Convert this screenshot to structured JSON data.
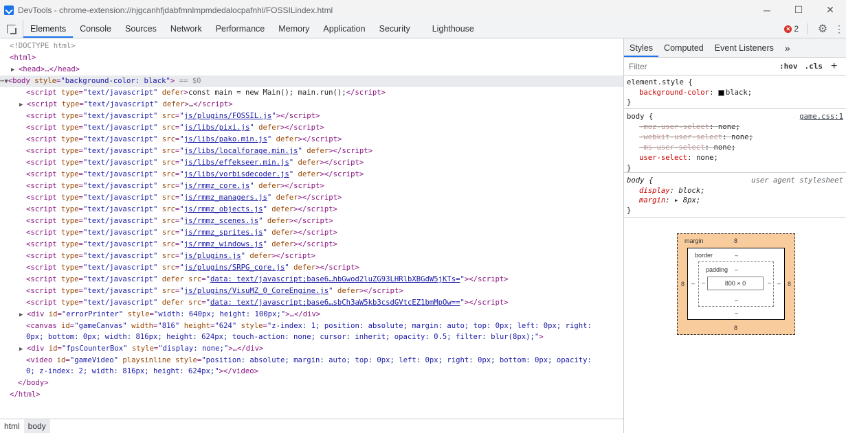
{
  "window": {
    "title": "DevTools - chrome-extension://njgcanhfjdabfmnlmpmdedalocpafnhl/FOSSILindex.html",
    "controls": [
      "─",
      "☐",
      "✕"
    ]
  },
  "tabs": [
    "Elements",
    "Console",
    "Sources",
    "Network",
    "Performance",
    "Memory",
    "Application",
    "Security",
    "Lighthouse"
  ],
  "active_tab": "Elements",
  "error_count": "2",
  "dom": {
    "doctype": "<!DOCTYPE html>",
    "html_open": "<html>",
    "head": "<head>…</head>",
    "body_open_tag": "<body",
    "body_style_attr": "style",
    "body_style_val": "\"background-color: black\"",
    "body_close_bracket": ">",
    "body_eq": " == $0",
    "scripts": [
      {
        "pre": "type",
        "preval": "\"text/javascript\"",
        "kind": "defer-inline",
        "content": "const main = new Main(); main.run();"
      },
      {
        "pre": "type",
        "preval": "\"text/javascript\"",
        "kind": "defer-collapsed",
        "content": "…"
      },
      {
        "src": "js/plugins/FOSSIL.js",
        "defer": false
      },
      {
        "src": "js/libs/pixi.js",
        "defer": true
      },
      {
        "src": "js/libs/pako.min.js",
        "defer": true
      },
      {
        "src": "js/libs/localforage.min.js",
        "defer": true
      },
      {
        "src": "js/libs/effekseer.min.js",
        "defer": true
      },
      {
        "src": "js/libs/vorbisdecoder.js",
        "defer": true
      },
      {
        "src": "js/rmmz_core.js",
        "defer": true
      },
      {
        "src": "js/rmmz_managers.js",
        "defer": true
      },
      {
        "src": "js/rmmz_objects.js",
        "defer": true
      },
      {
        "src": "js/rmmz_scenes.js",
        "defer": true
      },
      {
        "src": "js/rmmz_sprites.js",
        "defer": true
      },
      {
        "src": "js/rmmz_windows.js",
        "defer": true
      },
      {
        "src": "js/plugins.js",
        "defer": true
      },
      {
        "src": "js/plugins/SRPG_core.js",
        "defer": true
      }
    ],
    "data_script_1": "data: text/javascript;base6…hbGwod2luZG93LHRlbXBGdW5jKTs=",
    "visumz_src": "js/plugins/VisuMZ_0_CoreEngine.js",
    "data_script_2": "data: text/javascript;base6…sbCh3aW5kb3csdGVtcEZ1bmMpOw==",
    "error_printer_id": "\"errorPrinter\"",
    "error_printer_style": "\"width: 640px; height: 100px;\"",
    "canvas_line1_a": "\"gameCanvas\"",
    "canvas_width": "\"816\"",
    "canvas_height": "\"624\"",
    "canvas_style_1": "\"z-index: 1; position: absolute; margin: auto; top: 0px; left: 0px; right:",
    "canvas_style_2": "0px; bottom: 0px; width: 816px; height: 624px; touch-action: none; cursor: inherit; opacity: 0.5; filter: blur(8px);\"",
    "fps_id": "\"fpsCounterBox\"",
    "fps_style": "\"display: none;\"",
    "video_id": "\"gameVideo\"",
    "video_style_1": "\"position: absolute; margin: auto; top: 0px; left: 0px; right: 0px; bottom: 0px; opacity:",
    "video_style_2": "0; z-index: 2; width: 816px; height: 624px;\"",
    "body_close": "</body>",
    "html_close": "</html>"
  },
  "breadcrumbs": [
    "html",
    "body"
  ],
  "styles": {
    "tabs": [
      "Styles",
      "Computed",
      "Event Listeners"
    ],
    "more": "»",
    "filter_placeholder": "Filter",
    "hov": ":hov",
    "cls": ".cls",
    "plus": "+",
    "element_style_selector": "element.style {",
    "element_style_prop": "background-color",
    "element_style_val": "black;",
    "close_brace": "}",
    "body_rule_selector": "body {",
    "body_rule_origin": "game.css:1",
    "body_rule_props": [
      {
        "prop": "-moz-user-select",
        "val": "none;",
        "struck": true
      },
      {
        "prop": "-webkit-user-select",
        "val": "none;",
        "struck": true
      },
      {
        "prop": "-ms-user-select",
        "val": "none;",
        "struck": true
      },
      {
        "prop": "user-select",
        "val": "none;",
        "struck": false
      }
    ],
    "ua_selector": "body {",
    "ua_origin": "user agent stylesheet",
    "ua_display_prop": "display",
    "ua_display_val": "block;",
    "ua_margin_prop": "margin",
    "ua_margin_val": "▸ 8px;"
  },
  "box_model": {
    "margin_label": "margin",
    "margin_top": "8",
    "margin_bottom": "8",
    "margin_left": "8",
    "margin_right": "8",
    "border_label": "border",
    "border_top": "–",
    "border_bottom": "–",
    "border_left": "–",
    "border_right": "–",
    "padding_label": "padding",
    "padding_top": "–",
    "padding_bottom": "–",
    "padding_left": "–",
    "padding_right": "–",
    "content": "800 × 0"
  }
}
